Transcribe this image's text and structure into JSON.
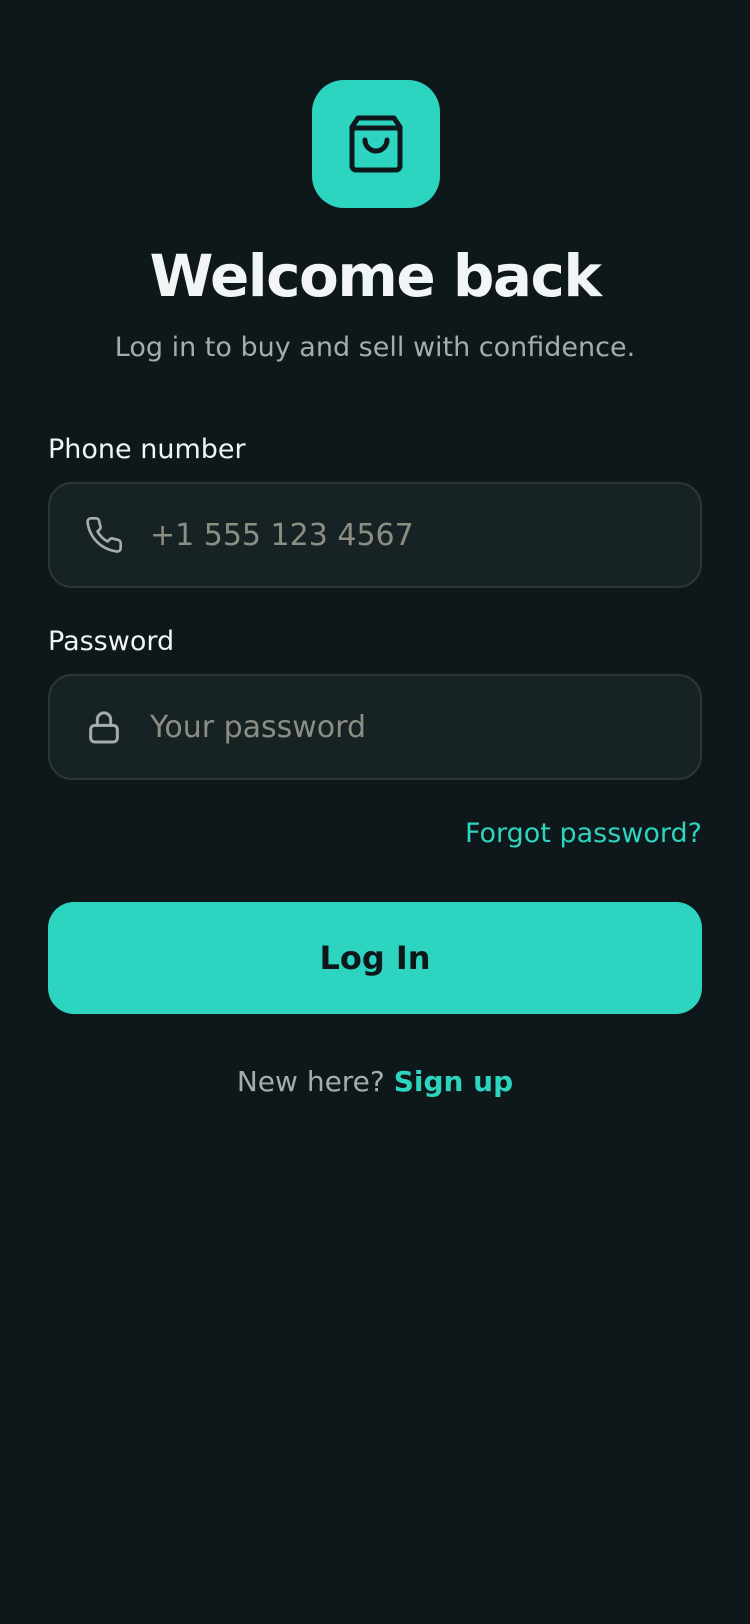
{
  "header": {
    "logo_icon": "shopping-bag-icon",
    "title": "Welcome back",
    "subtitle": "Log in to buy and sell with confidence."
  },
  "form": {
    "phone": {
      "label": "Phone number",
      "placeholder": "+1 555 123 4567",
      "value": "",
      "icon": "phone-icon"
    },
    "password": {
      "label": "Password",
      "placeholder": "Your password",
      "value": "",
      "icon": "lock-icon"
    },
    "forgot_label": "Forgot password?",
    "submit_label": "Log In"
  },
  "footer": {
    "prompt": "New here?",
    "signup_label": "Sign up"
  },
  "colors": {
    "background": "#0e1719",
    "accent": "#2dd4bf",
    "field_bg": "#172224",
    "field_border": "#2a3638",
    "text_primary": "#f1f5f5",
    "text_muted": "#a3adad",
    "placeholder": "#8d8e83"
  }
}
